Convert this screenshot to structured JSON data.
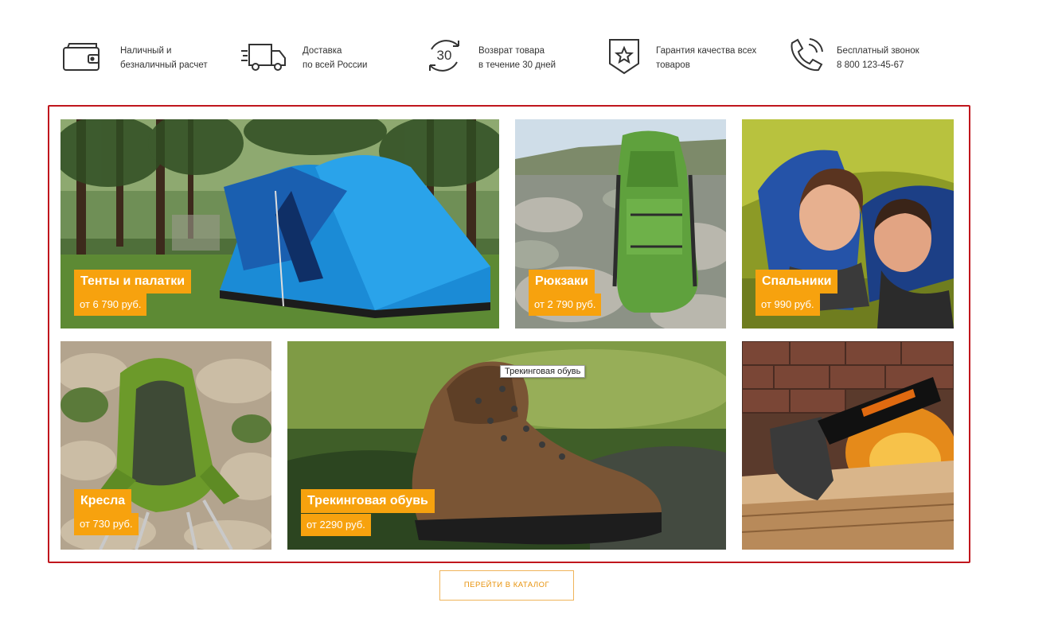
{
  "features": [
    {
      "icon": "wallet-icon",
      "line1": "Наличный и",
      "line2": "безналичный расчет"
    },
    {
      "icon": "delivery-truck-icon",
      "line1": "Доставка",
      "line2": "по всей России"
    },
    {
      "icon": "return-30-days-icon",
      "icon_text": "30",
      "line1": "Возврат товара",
      "line2": "в течение 30 дней"
    },
    {
      "icon": "quality-shield-star-icon",
      "line1": "Гарантия качества всех",
      "line2": "товаров"
    },
    {
      "icon": "phone-call-icon",
      "line1": "Бесплатный звонок",
      "line2": "8 800 123-45-67"
    }
  ],
  "categories": [
    {
      "title": "Тенты и палатки",
      "price": "от 6 790 руб."
    },
    {
      "title": "Рюкзаки",
      "price": "от 2 790 руб."
    },
    {
      "title": "Спальники",
      "price": "от 990 руб."
    },
    {
      "title": "Кресла",
      "price": "от 730 руб."
    },
    {
      "title": "Трекинговая обувь",
      "price": "от 2290 руб."
    },
    {
      "title": "",
      "price": ""
    }
  ],
  "tooltip": "Трекинговая обувь",
  "catalog_button": "ПЕРЕЙТИ В КАТАЛОГ",
  "colors": {
    "accent_orange": "#f7a20e",
    "frame_red": "#c0161d",
    "button_text": "#e8920a"
  }
}
